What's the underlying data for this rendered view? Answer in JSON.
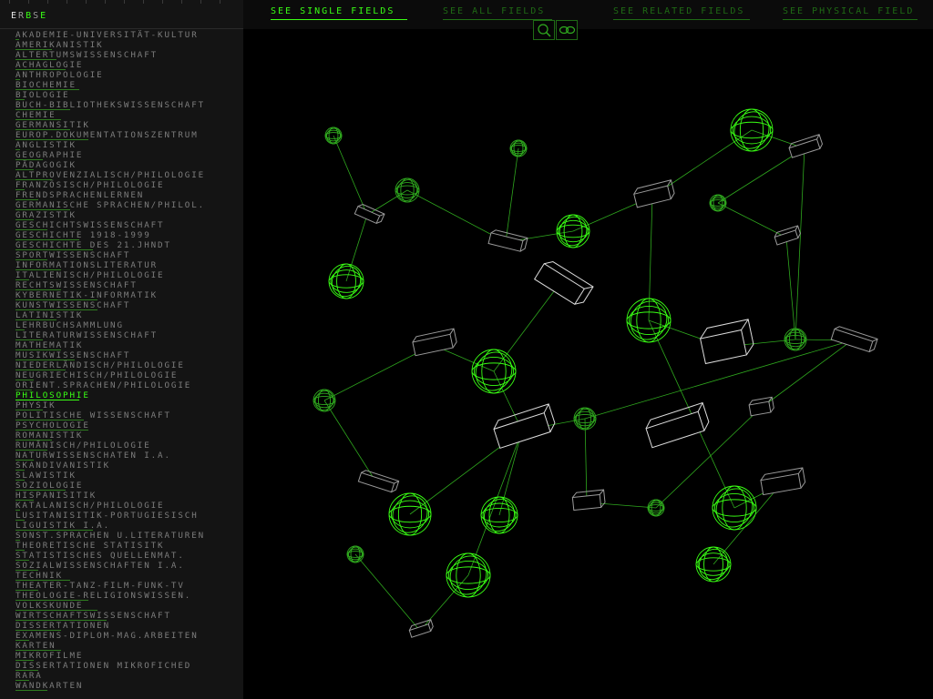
{
  "brand": {
    "letters": [
      "E",
      "R",
      "B",
      "S",
      "E"
    ]
  },
  "tabs": [
    {
      "label": "SEE SINGLE FIELDS",
      "active": true
    },
    {
      "label": "SEE ALL FIELDS",
      "active": false
    },
    {
      "label": "SEE RELATED FIELDS",
      "active": false
    },
    {
      "label": "SEE PHYSICAL FIELD",
      "active": false
    }
  ],
  "tools": [
    {
      "icon": "magnifier-icon"
    },
    {
      "icon": "infinity-icon"
    }
  ],
  "fields": [
    "AKADEMIE-UNIVERSITÄT-KULTUR",
    "AMERIKANISTIK",
    "ALTERTUMSWISSENSCHAFT",
    "ACHAGLOGIE",
    "ANTHROPOLOGIE",
    "BIOCHEMIE",
    "BIOLOGIE",
    "BUCH-BIBLIOTHEKSWISSENSCHAFT",
    "CHEMIE",
    "GERMANSITIK",
    "EUROP.DOKUMENTATIONSZENTRUM",
    "ANGLISTIK",
    "GEOGRAPHIE",
    "PÄDAGOGIK",
    "ALTPROVENZIALISCH/PHILOLOGIE",
    "FRANZÖSISCH/PHILOLOGIE",
    "FRENDSPRACHENLERNEN",
    "GERMANISCHE SPRACHEN/PHILOL.",
    "GRAZISTIK",
    "GESCHICHTSWISSENSCHAFT",
    "GESCHICHTE 1918-1999",
    "GESCHICHTE DES 21.JHNDT",
    "SPORTWISSENSCHAFT",
    "INFORMATIONSLITERATUR",
    "ITALIENISCH/PHILOLOGIE",
    "RECHTSWISSENSCHAFT",
    "KYBERNETIK-INFORMATIK",
    "KUNSTWISSENSCHAFT",
    "LATINISTIK",
    "LEHRBUCHSAMMLUNG",
    "LITERATURWISSENSCHAFT",
    "MATHEMATIK",
    "MUSIKWISSENSCHAFT",
    "NIEDERLÄNDISCH/PHILOLOGIE",
    "NEUGRIECHISCH/PHILOLOGIE",
    "ORIENT.SPRACHEN/PHILOLOGIE",
    "PHILOSOPHIE",
    "PHYSIK",
    "POLITISCHE WISSENSCHAFT",
    "PSYCHOLOGIE",
    "ROMANISTIK",
    "RUMÄNISCH/PHILOLOGIE",
    "NATURWISSENSCHATEN I.A.",
    "SKANDIVANISTIK",
    "SLAWISTIK",
    "SOZIOLOGIE",
    "HISPANISITIK",
    "KATALANISCH/PHILOLOGIE",
    "LUSITANISITIK-PORTUGIESISCH",
    "LIGUISTIK I.A.",
    "SONST.SPRACHEN U.LITERATUREN",
    "THEORETISCHE STATISITK",
    "STATISTISCHES QUELLENMAT.",
    "SOZIALWISSENSCHAFTEN I.A.",
    "TECHNIK",
    "THEATER-TANZ-FILM-FUNK-TV",
    "THEOLOGIE-RELIGIONSWISSEN.",
    "VOLKSKUNDE",
    "WIRTSCHAFTSWISSENSCHAFT",
    "DISSERTATIONEN",
    "EXAMENS-DIPLOM-MAG.ARBEITEN",
    "KARTEN",
    "MIKROFILME",
    "DISSERTATIONEN MIKROFICHED",
    "RARA",
    "WANDKARTEN"
  ],
  "active_field": "PHILOSOPHIE",
  "colors": {
    "accent": "#39ff14",
    "dim_green": "#1f6a15",
    "edge": "#2fa81e",
    "box_outline": "#dcdcdc",
    "text_gray": "#7d7d7d",
    "sidebar_bg": "#141414"
  }
}
